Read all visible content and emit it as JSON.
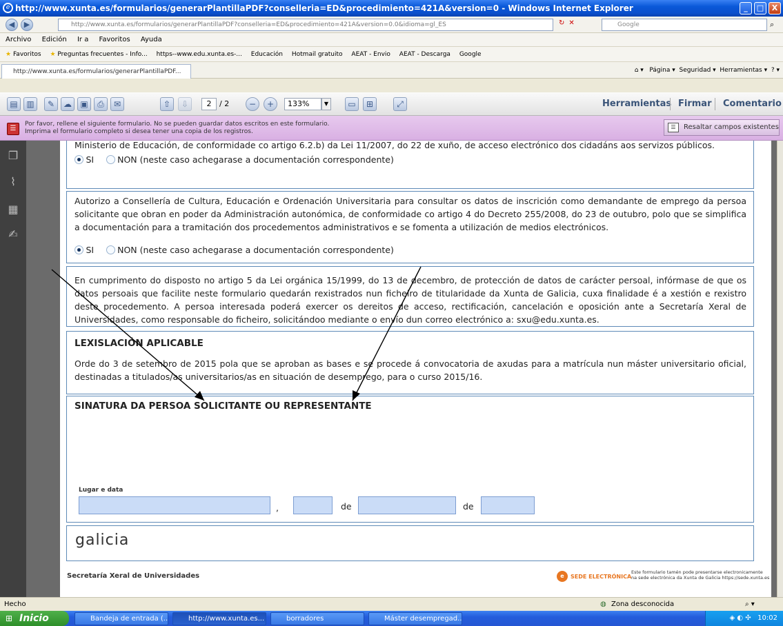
{
  "window": {
    "title": "http://www.xunta.es/formularios/generarPlantillaPDF?conselleria=ED&procedimiento=421A&version=0 - Windows Internet Explorer",
    "min": "_",
    "max": "□",
    "close": "X"
  },
  "address": {
    "url": "http://www.xunta.es/formularios/generarPlantillaPDF?conselleria=ED&procedimiento=421A&version=0.0&idioma=gl_ES",
    "search_placeholder": "Google"
  },
  "menu": [
    "Archivo",
    "Edición",
    "Ir a",
    "Favoritos",
    "Ayuda"
  ],
  "favorites": {
    "label": "Favoritos",
    "items": [
      "Preguntas frecuentes - Info...",
      "https--www.edu.xunta.es-...",
      "Educación",
      "Hotmail gratuito",
      "AEAT - Envio",
      "AEAT - Descarga",
      "Google"
    ]
  },
  "tab": {
    "label": "http://www.xunta.es/formularios/generarPlantillaPDF..."
  },
  "command_bar": [
    "Página ▾",
    "Seguridad ▾",
    "Herramientas ▾"
  ],
  "pdf_toolbar": {
    "page_current": "2",
    "page_total": "/ 2",
    "zoom": "133%",
    "tools": "Herramientas",
    "sign": "Firmar",
    "comment": "Comentario"
  },
  "notice": {
    "line1": "Por favor, rellene el siguiente formulario. No se pueden guardar datos escritos en este formulario.",
    "line2": "Imprima el formulario completo si desea tener una copia de los registros.",
    "highlight_button": "Resaltar campos existentes"
  },
  "form": {
    "block1_text": "Ministerio de Educación, de conformidade co artigo 6.2.b) da Lei 11/2007, do 22 de xuño, de acceso electrónico dos cidadáns aos servizos públicos.",
    "yes": "SI",
    "no": "NON (neste caso achegarase a documentación correspondente)",
    "block2_text": "Autorizo a Consellería de Cultura, Educación e Ordenación Universitaria para consultar os datos de inscrición como demandante de emprego da persoa solicitante que obran en poder da Administración autonómica, de conformidade co artigo 4 do Decreto 255/2008, do 23 de outubro, polo que se simplifica a documentación para a tramitación dos procedementos administrativos e se fomenta a utilización de medios electrónicos.",
    "privacy_text": "En cumprimento do disposto no artigo 5 da Lei orgánica 15/1999, do 13 de decembro, de protección de datos de carácter persoal, infórmase de que os datos persoais que facilite neste formulario quedarán rexistrados nun ficheiro de titularidade da Xunta de Galicia, cuxa finalidade é a xestión e rexistro deste procedemento. A persoa interesada poderá exercer os dereitos de acceso, rectificación, cancelación e oposición ante a Secretaría Xeral de Universidades, como responsable do ficheiro, solicitándoo mediante o envío dun correo electrónico a: sxu@edu.xunta.es.",
    "law_title": "LEXISLACIÓN APLICABLE",
    "law_text": "Orde do 3 de setembro de 2015 pola que se aproban as bases e se procede á convocatoria de axudas para a matrícula nun máster universitario oficial, destinadas a titulados/as universitarios/as en situación de desemprego, para o curso 2015/16.",
    "signature_title": "SINATURA DA PERSOA SOLICITANTE OU REPRESENTANTE",
    "place_date_label": "Lugar e data",
    "comma": ",",
    "de1": "de",
    "de2": "de",
    "logo_text": "galicia",
    "footer_left": "Secretaría Xeral de Universidades",
    "sede_label": "SEDE ELECTRÓNICA",
    "sede_note1": "Este formulario tamén pode presentarse electronicamente",
    "sede_note2": "na sede electrónica da Xunta de Galicia https://sede.xunta.es"
  },
  "status": {
    "left": "Hecho",
    "zone": "Zona desconocida"
  },
  "taskbar": {
    "start": "Inicio",
    "tasks": [
      "Bandeja de entrada (...",
      "http://www.xunta.es...",
      "borradores",
      "Máster desempregad..."
    ],
    "clock": "10:02"
  },
  "colors": {
    "field_fill": "#cadcf7",
    "box_border": "#5d8ab7",
    "notice_bg": "#d9b0e3"
  }
}
